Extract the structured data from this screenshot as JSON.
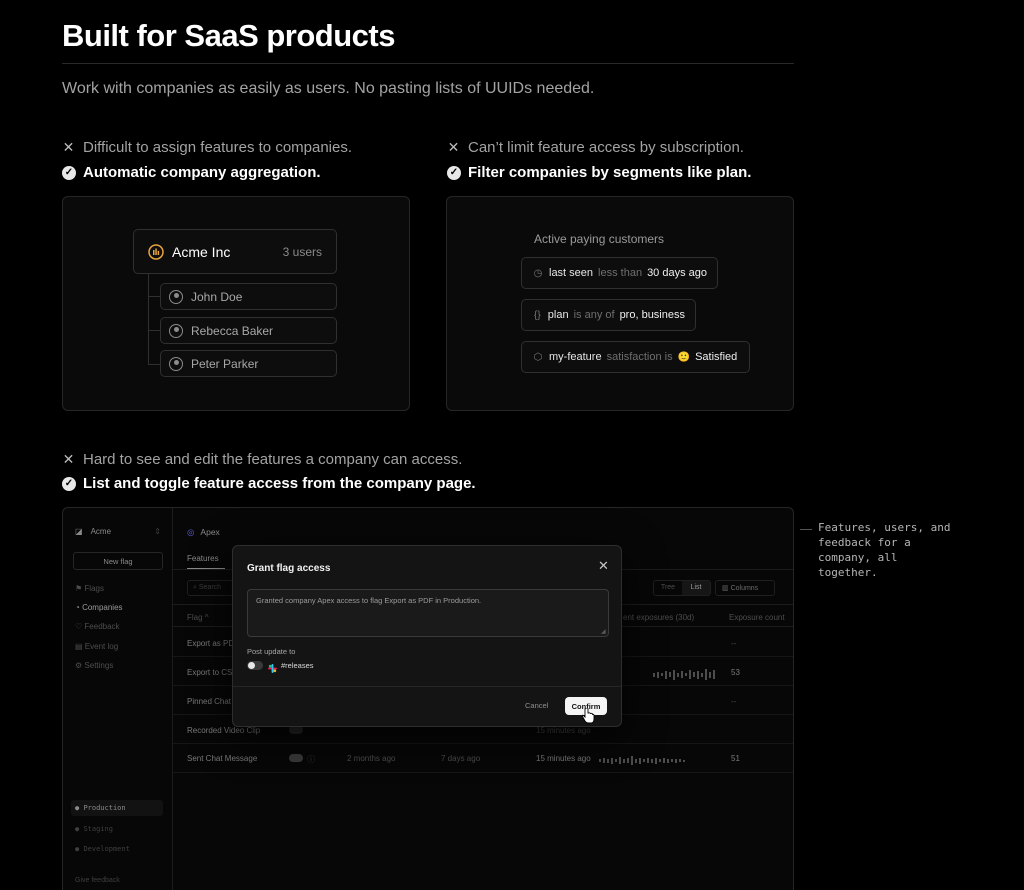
{
  "header": {
    "title": "Built for SaaS products",
    "subtitle": "Work with companies as easily as users. No pasting lists of UUIDs needed."
  },
  "features": [
    {
      "problem": "Difficult to assign features to companies.",
      "solution": "Automatic company aggregation."
    },
    {
      "problem": "Can’t limit feature access by subscription.",
      "solution": "Filter companies by segments like plan."
    },
    {
      "problem": "Hard to see and edit the features a company can access.",
      "solution": "List and toggle feature access from the company page."
    }
  ],
  "company_card": {
    "company_name": "Acme Inc",
    "user_count": "3 users",
    "users": [
      "John Doe",
      "Rebecca Baker",
      "Peter Parker"
    ]
  },
  "segment_card": {
    "title": "Active paying customers",
    "filters": [
      {
        "icon": "clock-icon",
        "key": "last seen",
        "op": "less than",
        "value": "30 days ago"
      },
      {
        "icon": "braces-icon",
        "key": "plan",
        "op": "is any of",
        "value": "pro, business"
      },
      {
        "icon": "cube-icon",
        "key": "my-feature",
        "op": "satisfaction is",
        "value": "Satisfied",
        "emoji": "🙂"
      }
    ]
  },
  "app": {
    "org": "Acme",
    "new_flag": "New flag",
    "nav": [
      "Flags",
      "Companies",
      "Feedback",
      "Event log",
      "Settings"
    ],
    "environments": [
      "Production",
      "Staging",
      "Development"
    ],
    "give_feedback": "Give feedback",
    "company": "Apex",
    "tab": "Features",
    "search_placeholder": "Search",
    "view_options": [
      "Tree",
      "List"
    ],
    "columns_label": "Columns",
    "col_flag": "Flag",
    "col_exposures": "ent exposures (30d)",
    "col_exposure_count": "Exposure count",
    "rows": [
      {
        "flag": "Export as PDF",
        "a": "",
        "b": "",
        "c": "",
        "count": "",
        "tail": "--"
      },
      {
        "flag": "Export to CSV",
        "a": "",
        "b": "",
        "c": "",
        "count": "53",
        "tail": ""
      },
      {
        "flag": "Pinned Chat",
        "a": "",
        "b": "",
        "c": "",
        "count": "",
        "tail": "--"
      },
      {
        "flag": "Recorded Video Clip",
        "a": "",
        "b": "",
        "c": "15 minutes ago",
        "count": "",
        "tail": ""
      },
      {
        "flag": "Sent Chat Message",
        "a": "2 months ago",
        "b": "7 days ago",
        "c": "15 minutes ago",
        "count": "51",
        "tail": ""
      }
    ]
  },
  "modal": {
    "title": "Grant flag access",
    "message": "Granted company Apex access to flag Export as PDF in Production.",
    "post_label": "Post update to",
    "channel": "#releases",
    "cancel": "Cancel",
    "confirm": "Confirm"
  },
  "side_note": "Features, users, and feedback for a company, all together."
}
